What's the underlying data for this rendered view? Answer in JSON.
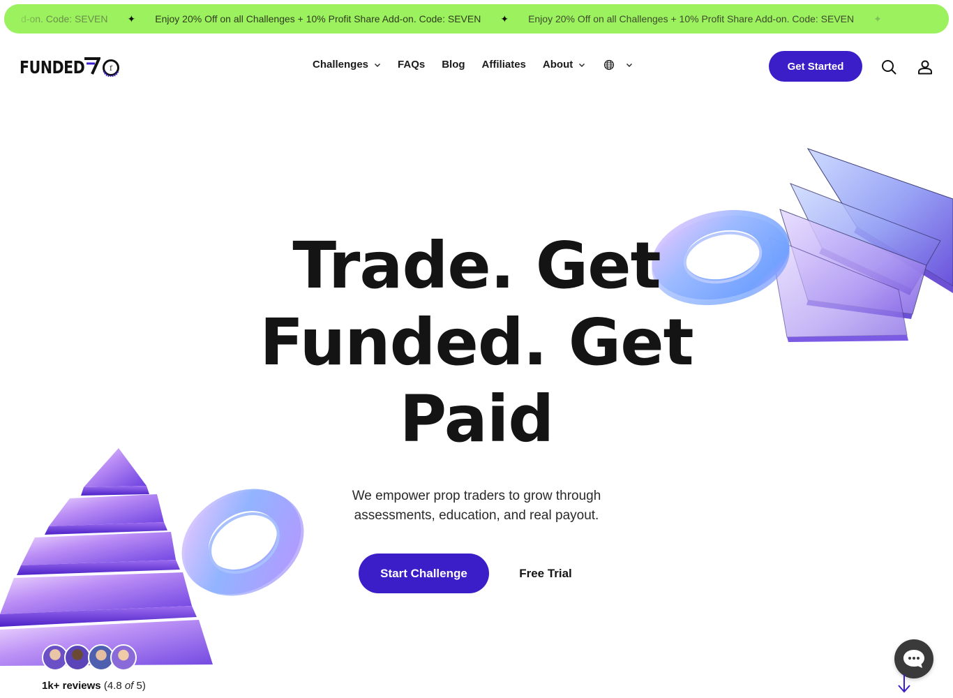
{
  "promo": {
    "items": [
      "d-on. Code: SEVEN",
      "Enjoy 20% Off on all Challenges + 10% Profit Share Add-on. Code: SEVEN",
      "Enjoy 20% Off on all Challenges + 10% Profit Share Add-on. Code: SEVEN"
    ],
    "separator": "✦",
    "color": "#9cf25e"
  },
  "header": {
    "logo_text": "FUNDED",
    "logo_mark_letter": "f",
    "nav": [
      {
        "label": "Challenges",
        "has_dropdown": true
      },
      {
        "label": "FAQs",
        "has_dropdown": false
      },
      {
        "label": "Blog",
        "has_dropdown": false
      },
      {
        "label": "Affiliates",
        "has_dropdown": false
      },
      {
        "label": "About",
        "has_dropdown": true
      }
    ],
    "language_icon": "globe-icon",
    "cta_label": "Get Started",
    "search_icon": "search-icon",
    "account_icon": "user-icon"
  },
  "hero": {
    "title_line1": "Trade. Get",
    "title_line2": "Funded. Get",
    "title_line3": "Paid",
    "subtitle_line1": "We empower prop traders to grow through",
    "subtitle_line2": "assessments, education, and real payout.",
    "primary_cta": "Start Challenge",
    "secondary_cta": "Free Trial"
  },
  "reviews": {
    "count_label": "1k+ reviews",
    "rating_open": "(4.8 ",
    "rating_of": "of",
    "rating_close": " 5)"
  },
  "colors": {
    "accent": "#3b1ec8",
    "promo_bg": "#9cf25e",
    "text": "#141414"
  },
  "chat": {
    "icon": "chat-bubble-icon",
    "scroll_icon": "arrow-down-icon"
  }
}
